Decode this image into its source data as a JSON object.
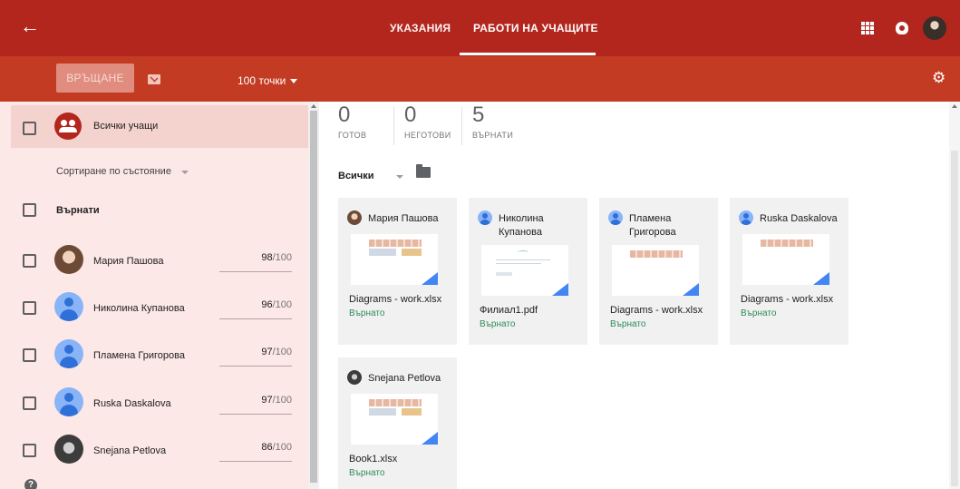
{
  "header": {
    "back_icon": "arrow-left-icon",
    "tabs": [
      {
        "label": "УКАЗАНИЯ",
        "active": false
      },
      {
        "label": "РАБОТИ НА УЧАЩИТЕ",
        "active": true
      }
    ],
    "icons": [
      "apps-grid-icon",
      "notifications-icon",
      "user-avatar"
    ]
  },
  "toolbar": {
    "return_label": "ВРЪЩАНЕ",
    "mail_icon": "mail-icon",
    "points_label": "100 точки",
    "settings_icon": "gear-icon"
  },
  "roster": {
    "all_label": "Всички учащи",
    "sort_label": "Сортиране по състояние",
    "section_label": "Върнати",
    "students": [
      {
        "name": "Мария Пашова",
        "score": "98",
        "max": "/100",
        "avatar": "photo1"
      },
      {
        "name": "Николина Купанова",
        "score": "96",
        "max": "/100",
        "avatar": "default"
      },
      {
        "name": "Пламена Григорова",
        "score": "97",
        "max": "/100",
        "avatar": "default"
      },
      {
        "name": "Ruska Daskalova",
        "score": "97",
        "max": "/100",
        "avatar": "default"
      },
      {
        "name": "Snejana Petlova",
        "score": "86",
        "max": "/100",
        "avatar": "photo2"
      }
    ],
    "help_label": "?"
  },
  "stats": [
    {
      "value": "0",
      "label": "ГОТОВ"
    },
    {
      "value": "0",
      "label": "НЕГОТОВИ"
    },
    {
      "value": "5",
      "label": "ВЪРНАТИ"
    }
  ],
  "filter": {
    "label": "Всички"
  },
  "cards": [
    {
      "name": "Мария Пашова",
      "file": "Diagrams - work.xlsx",
      "status": "Върнато",
      "avatar": "photo1",
      "type": "sheet"
    },
    {
      "name": "Николина Купанова",
      "file": "Филиал1.pdf",
      "status": "Върнато",
      "avatar": "default",
      "type": "pdf"
    },
    {
      "name": "Пламена Григорова",
      "file": "Diagrams - work.xlsx",
      "status": "Върнато",
      "avatar": "default",
      "type": "sheet"
    },
    {
      "name": "Ruska Daskalova",
      "file": "Diagrams - work.xlsx",
      "status": "Върнато",
      "avatar": "default",
      "type": "sheet"
    },
    {
      "name": "Snejana Petlova",
      "file": "Book1.xlsx",
      "status": "Върнато",
      "avatar": "photo2",
      "type": "sheet"
    }
  ],
  "colors": {
    "header": "#b3261e",
    "toolbar": "#c23b22",
    "roster_bg": "#fce8e6",
    "returned_status": "#2e8b57"
  }
}
